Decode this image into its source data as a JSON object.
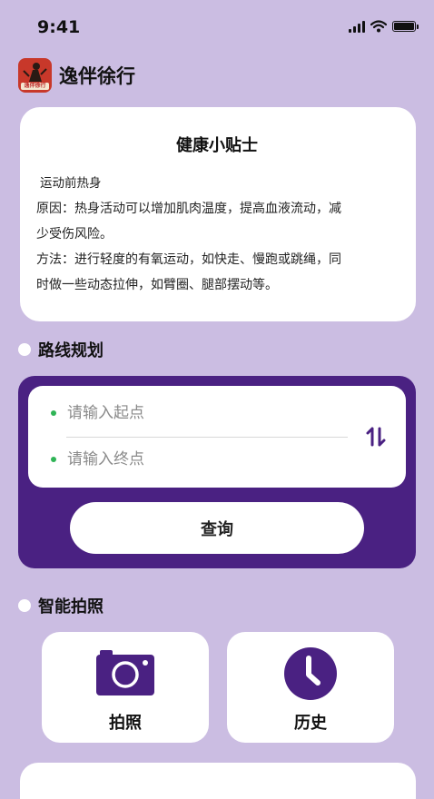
{
  "status_bar": {
    "time": "9:41"
  },
  "app": {
    "title": "逸伴徐行",
    "logo_text": "逸伴徐行"
  },
  "tips": {
    "title": "健康小贴士",
    "subtitle": "运动前热身",
    "lines": [
      "原因：热身活动可以增加肌肉温度，提高血液流动，减",
      "少受伤风险。",
      "方法：进行轻度的有氧运动，如快走、慢跑或跳绳，同",
      "时做一些动态拉伸，如臂圈、腿部摆动等。"
    ]
  },
  "route": {
    "section_title": "路线规划",
    "start_placeholder": "请输入起点",
    "end_placeholder": "请输入终点",
    "query_label": "查询"
  },
  "photo": {
    "section_title": "智能拍照",
    "camera_label": "拍照",
    "history_label": "历史"
  },
  "colors": {
    "background": "#cbbde2",
    "accent": "#4a2182",
    "dot": "#2fb456"
  },
  "icons": [
    "signal-icon",
    "wifi-icon",
    "battery-icon",
    "swap-icon",
    "camera-icon",
    "clock-icon"
  ]
}
